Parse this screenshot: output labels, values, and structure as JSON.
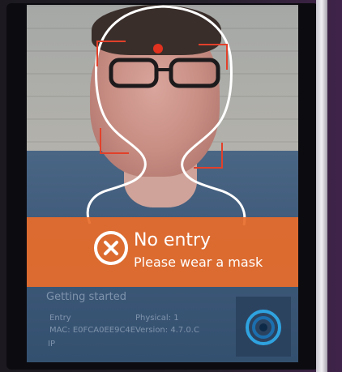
{
  "status": {
    "title": "No entry",
    "message": "Please wear a mask"
  },
  "info": {
    "heading": "Getting started",
    "device_label": "Entry",
    "mac": "MAC: E0FCA0EE9C4E",
    "ip_label": "IP",
    "physical": "Physical: 1",
    "version": "Version: 4.7.0.C"
  },
  "icons": {
    "banner_icon": "close-circle-icon",
    "camera_icon": "camera-lens-icon"
  },
  "colors": {
    "banner": "#e96c2a",
    "target": "#e2402a",
    "outline": "#ffffff"
  }
}
